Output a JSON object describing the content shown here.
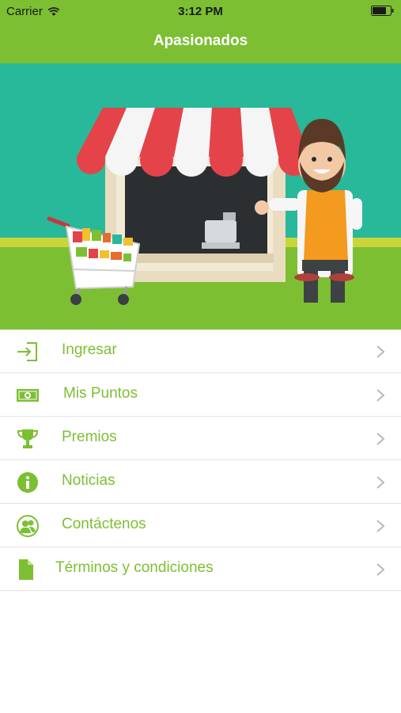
{
  "status_bar": {
    "carrier": "Carrier",
    "time": "3:12 PM",
    "wifi_icon": "wifi-icon",
    "battery_icon": "battery-icon"
  },
  "nav": {
    "title": "Apasionados"
  },
  "hero": {
    "image": "store-shopkeeper-illustration"
  },
  "menu": {
    "items": [
      {
        "label": "Ingresar",
        "icon": "login-icon"
      },
      {
        "label": "Mis Puntos",
        "icon": "money-icon"
      },
      {
        "label": "Premios",
        "icon": "trophy-icon"
      },
      {
        "label": "Noticias",
        "icon": "info-icon"
      },
      {
        "label": "Contáctenos",
        "icon": "contacts-icon"
      },
      {
        "label": "Términos y condiciones",
        "icon": "document-icon"
      }
    ]
  },
  "colors": {
    "brand_green": "#7dbf33",
    "hero_teal": "#28b89a",
    "separator": "#e3e3e3",
    "chevron": "#b8b8b8"
  }
}
